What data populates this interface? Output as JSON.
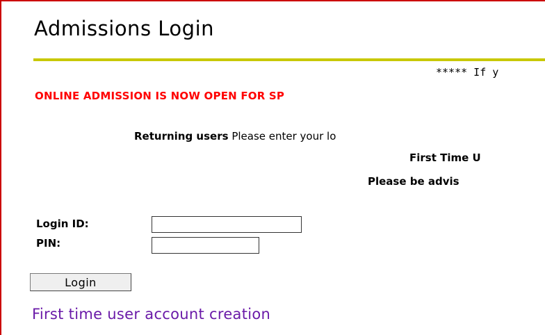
{
  "page": {
    "title": "Admissions Login",
    "notice_text": "***** If y",
    "online_admission_text": "ONLINE ADMISSION IS NOW OPEN FOR SP",
    "returning_users_bold": "Returning users",
    "returning_users_text": " Please enter your lo",
    "first_time_text": "First Time U",
    "advise_text": "Please be advis"
  },
  "form": {
    "login_id_label": "Login ID:",
    "login_id_value": "",
    "pin_label": "PIN:",
    "pin_value": "",
    "login_button_label": "Login"
  },
  "links": {
    "first_time_account": "First time user account creation"
  },
  "colors": {
    "border": "#cc0000",
    "rule": "#c8c800",
    "alert_text": "#ff0000",
    "link": "#6a1aa8"
  }
}
